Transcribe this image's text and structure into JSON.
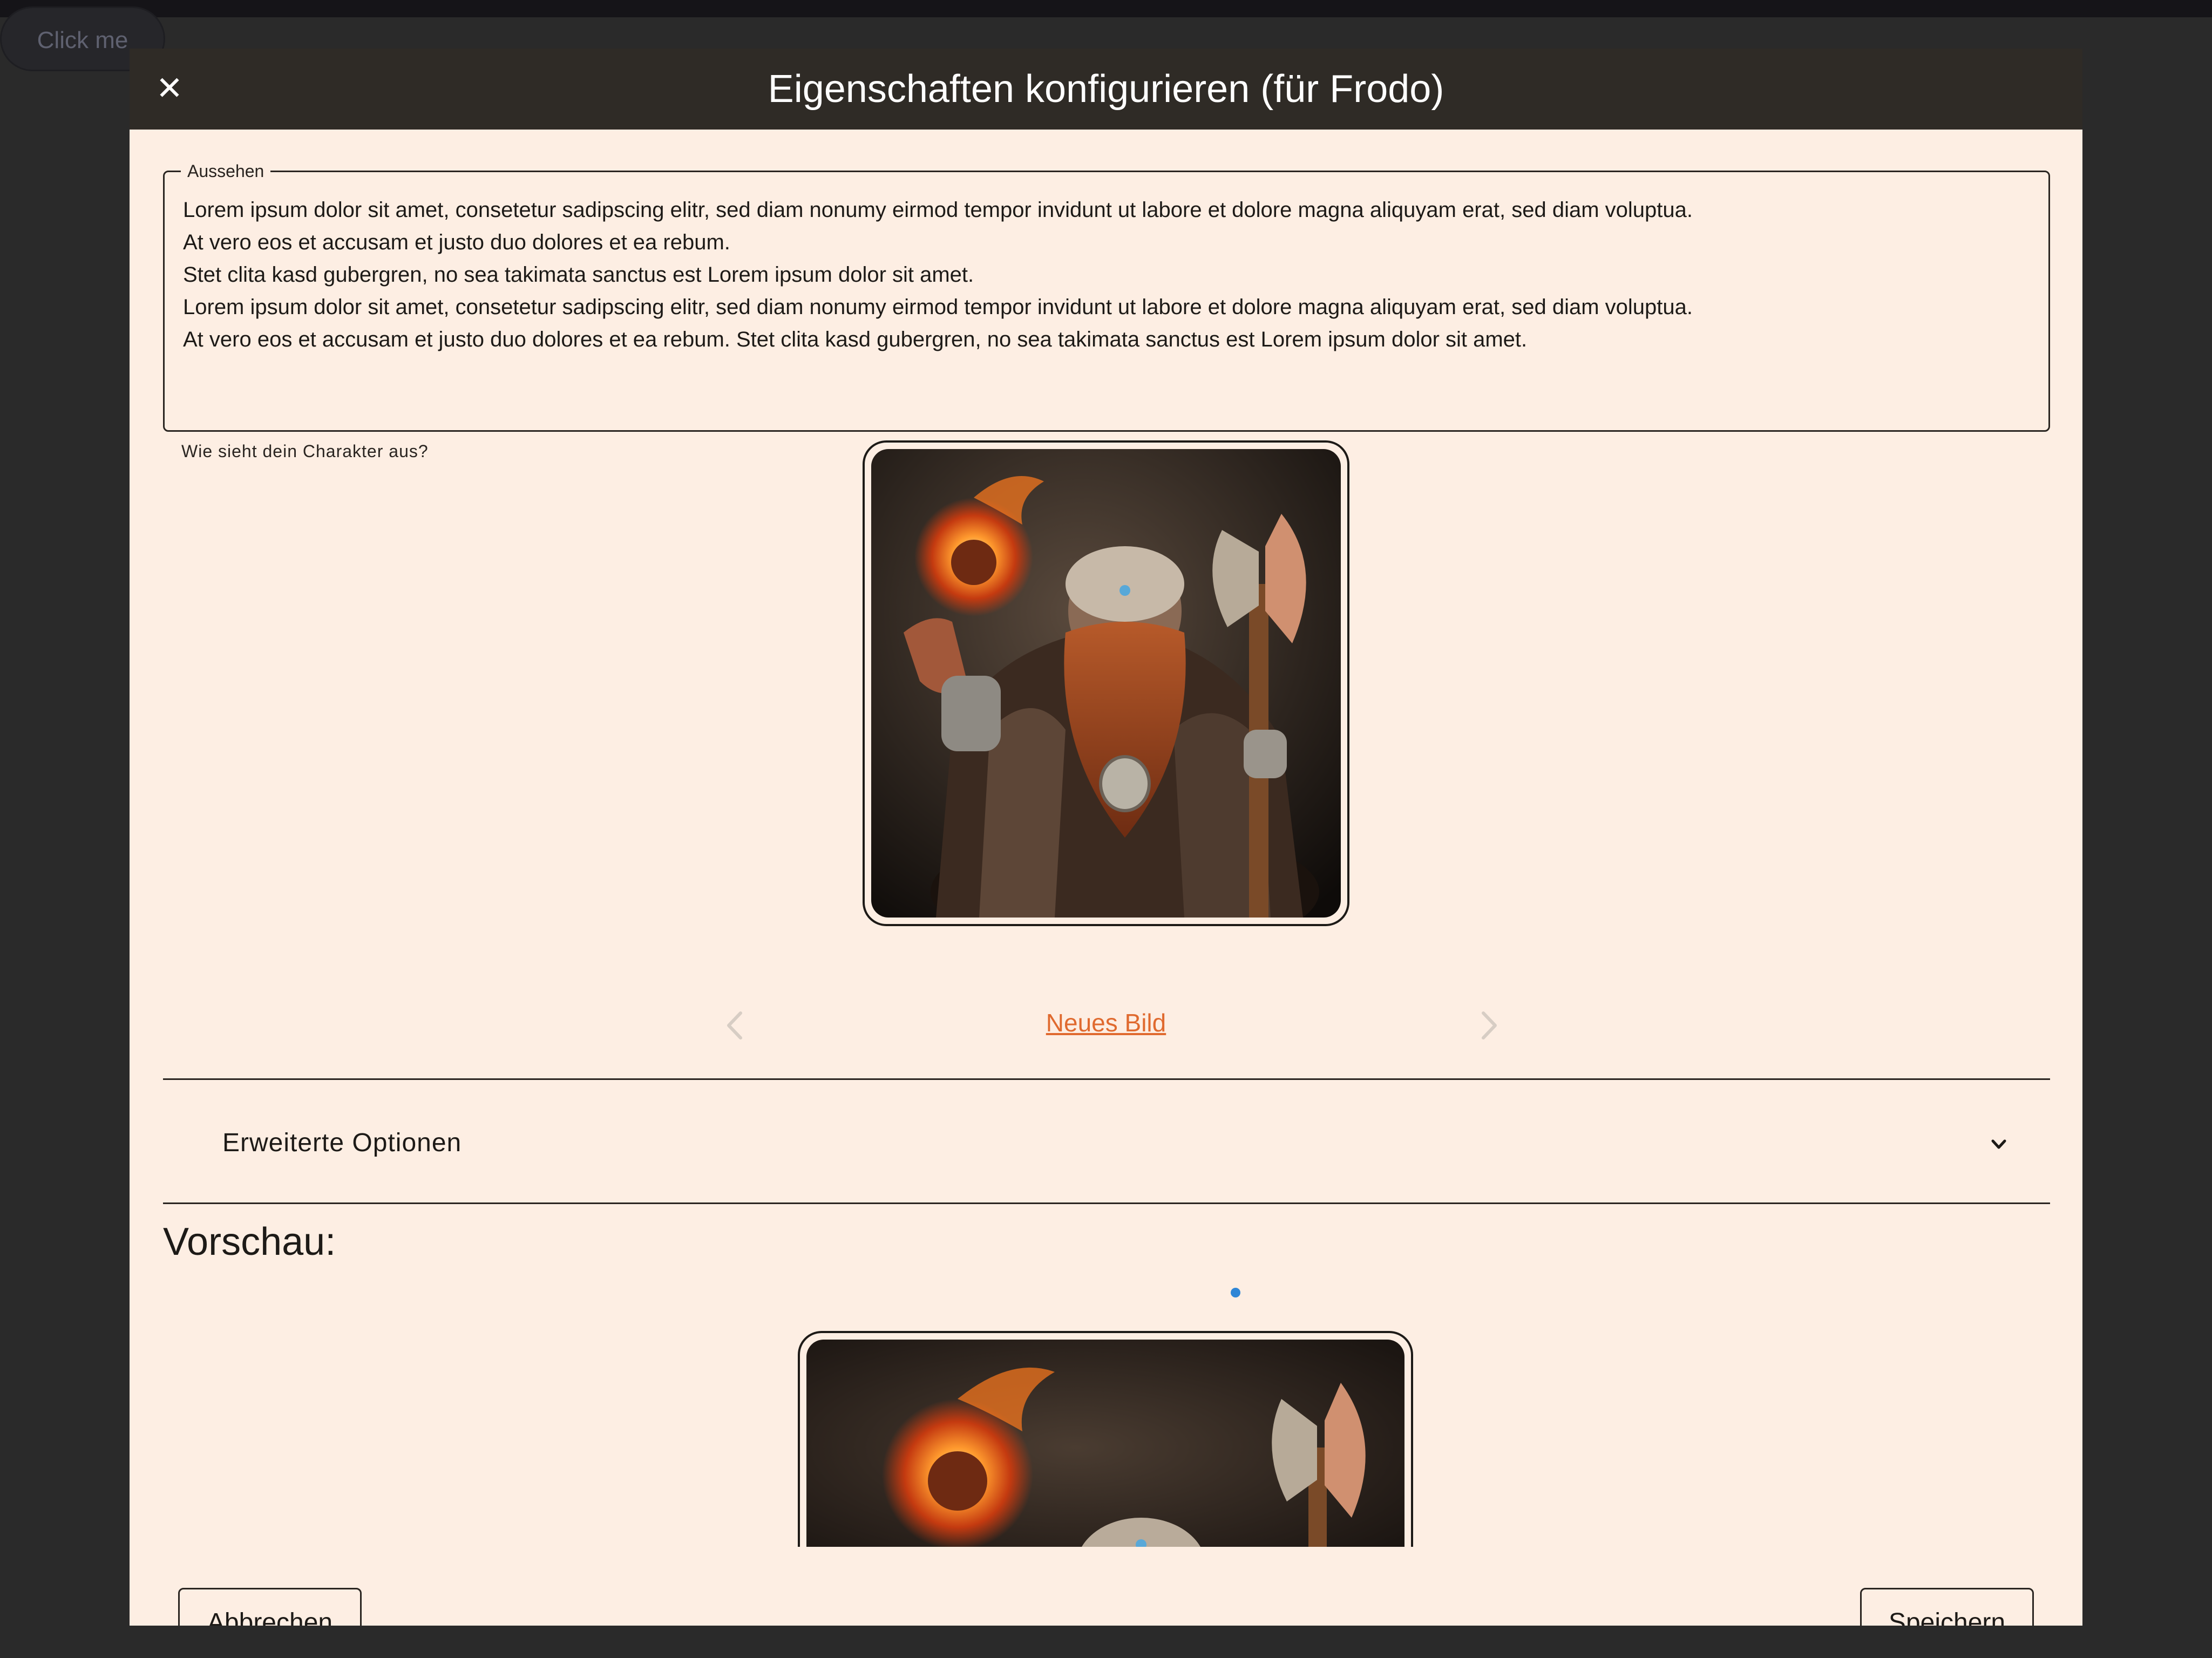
{
  "background": {
    "button_label": "Click me"
  },
  "modal": {
    "title": "Eigenschaften konfigurieren (für Frodo)",
    "close_icon": "close-icon"
  },
  "appearance": {
    "legend": "Aussehen",
    "lines": [
      "Lorem ipsum dolor sit amet, consetetur sadipscing elitr, sed diam nonumy eirmod tempor invidunt ut labore et dolore magna aliquyam erat, sed diam voluptua.",
      "At vero eos et accusam et justo duo dolores et ea rebum.",
      "Stet clita kasd gubergren, no sea takimata sanctus est Lorem ipsum dolor sit amet.",
      "Lorem ipsum dolor sit amet, consetetur sadipscing elitr, sed diam nonumy eirmod tempor invidunt ut labore et dolore magna aliquyam erat, sed diam voluptua.",
      "At vero eos et accusam et justo duo dolores et ea rebum. Stet clita kasd gubergren, no sea takimata sanctus est Lorem ipsum dolor sit amet."
    ],
    "helper": "Wie sieht dein Charakter aus?"
  },
  "image_carousel": {
    "new_image_label": "Neues Bild",
    "prev_icon": "chevron-left-icon",
    "next_icon": "chevron-right-icon"
  },
  "advanced": {
    "label": "Erweiterte Optionen",
    "chevron_icon": "chevron-down-icon"
  },
  "preview": {
    "title": "Vorschau:"
  },
  "footer": {
    "cancel_label": "Abbrechen",
    "save_label": "Speichern"
  },
  "colors": {
    "modal_background": "#fdeee3",
    "header_background": "#2f2b26",
    "link": "#e06a2f",
    "indicator": "#2f86d6"
  }
}
